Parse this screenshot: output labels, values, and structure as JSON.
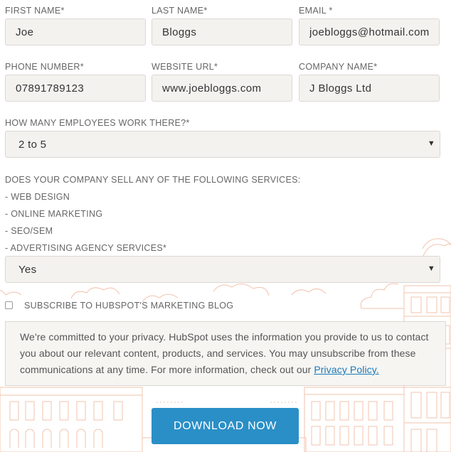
{
  "fields": {
    "first_name": {
      "label": "FIRST NAME*",
      "value": "Joe"
    },
    "last_name": {
      "label": "LAST NAME*",
      "value": "Bloggs"
    },
    "email": {
      "label": "EMAIL *",
      "value": "joebloggs@hotmail.com"
    },
    "phone": {
      "label": "PHONE NUMBER*",
      "value": "07891789123"
    },
    "website": {
      "label": "WEBSITE URL*",
      "value": "www.joebloggs.com"
    },
    "company": {
      "label": "COMPANY NAME*",
      "value": "J Bloggs Ltd"
    }
  },
  "employees": {
    "label": "HOW MANY EMPLOYEES WORK THERE?*",
    "selected": "2 to 5"
  },
  "services": {
    "question": "DOES YOUR COMPANY SELL ANY OF THE FOLLOWING SERVICES:",
    "items": [
      "- WEB DESIGN",
      "- ONLINE MARKETING",
      "- SEO/SEM",
      "- ADVERTISING AGENCY SERVICES*"
    ],
    "selected": "Yes"
  },
  "subscribe": {
    "label": "SUBSCRIBE TO HUBSPOT'S MARKETING BLOG",
    "checked": false
  },
  "privacy": {
    "text": "We're committed to your privacy. HubSpot uses the information you provide to us to contact you about our relevant content, products, and services. You may unsubscribe from these communications at any time. For more information, check out our ",
    "link": "Privacy Policy."
  },
  "download_label": "DOWNLOAD NOW",
  "icons": {
    "select_caret": "caret-down-icon"
  },
  "colors": {
    "accent": "#2a8fc6",
    "link": "#1b78b8",
    "illustration": "#f3c7b4"
  }
}
